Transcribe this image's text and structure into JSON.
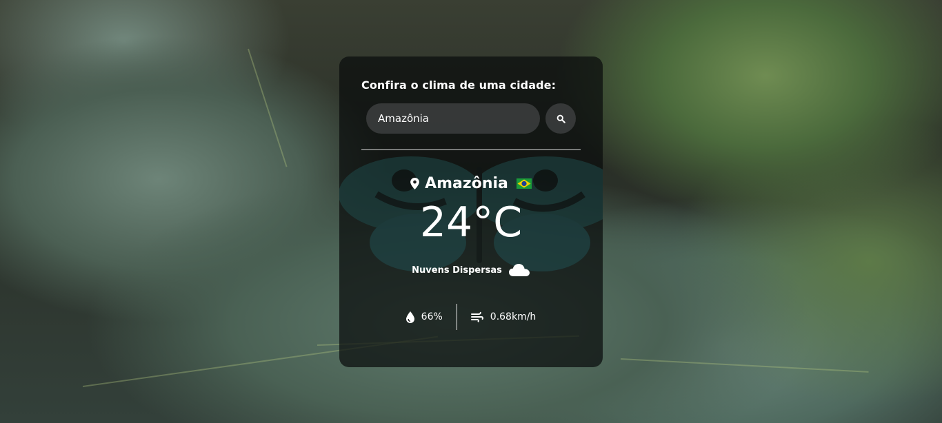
{
  "card": {
    "title": "Confira o clima de uma cidade:",
    "search": {
      "value": "Amazônia",
      "button_icon": "search-icon"
    },
    "weather": {
      "city": "Amazônia",
      "location_icon": "map-pin-icon",
      "flag_icon": "brazil-flag-icon",
      "temperature": "24",
      "unit": "°C",
      "description": "Nuvens Dispersas",
      "condition_icon": "cloud-icon",
      "humidity": "66%",
      "humidity_icon": "water-drop-icon",
      "wind": "0.68km/h",
      "wind_icon": "wind-icon"
    }
  },
  "colors": {
    "card_background": "#0a0c0c",
    "text": "#ffffff",
    "input_background": "#3c3e3e"
  }
}
